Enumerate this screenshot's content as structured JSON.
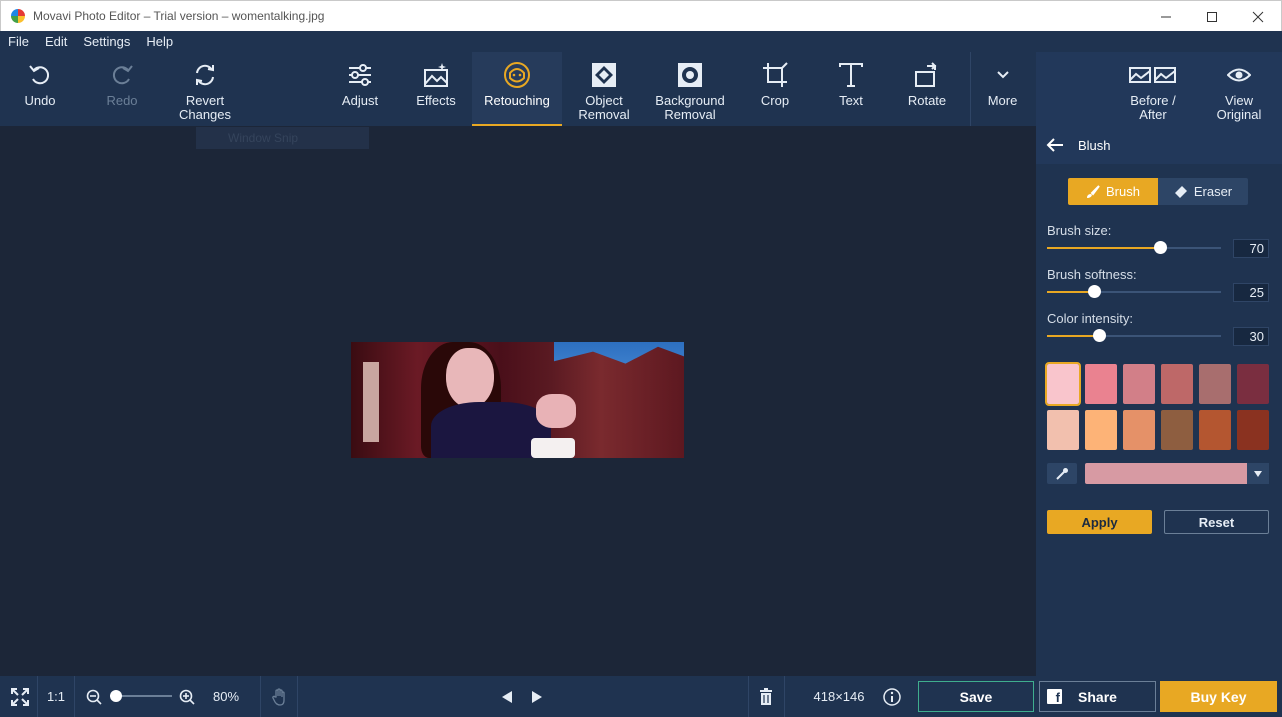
{
  "window": {
    "title": "Movavi Photo Editor – Trial version – womentalking.jpg",
    "controls": [
      "minimize",
      "maximize",
      "close"
    ]
  },
  "menu": [
    "File",
    "Edit",
    "Settings",
    "Help"
  ],
  "toolbar": {
    "undo": "Undo",
    "redo": "Redo",
    "revert": "Revert\nChanges",
    "adjust": "Adjust",
    "effects": "Effects",
    "retouching": "Retouching",
    "object_removal": "Object\nRemoval",
    "background_removal": "Background\nRemoval",
    "crop": "Crop",
    "text": "Text",
    "rotate": "Rotate",
    "more": "More",
    "before_after": "Before /\nAfter",
    "view_original": "View\nOriginal",
    "active_tool": "Retouching",
    "ghost_tooltip": "Window Snip"
  },
  "panel": {
    "title": "Blush",
    "brush_label": "Brush",
    "eraser_label": "Eraser",
    "active_mode": "Brush",
    "sliders": [
      {
        "label": "Brush size:",
        "value": "70",
        "fraction": 0.65
      },
      {
        "label": "Brush softness:",
        "value": "25",
        "fraction": 0.27
      },
      {
        "label": "Color intensity:",
        "value": "30",
        "fraction": 0.3
      }
    ],
    "swatches_row1": [
      "#f9c5cc",
      "#ea8290",
      "#d27f88",
      "#be6868",
      "#a86e6e",
      "#7a2e40"
    ],
    "swatches_row2": [
      "#f2c0ae",
      "#fdb377",
      "#e59168",
      "#8e5e40",
      "#b45630",
      "#8a3220"
    ],
    "selected_swatch": 0,
    "selected_color": "#d79aa3",
    "apply_label": "Apply",
    "reset_label": "Reset"
  },
  "statusbar": {
    "one_to_one": "1:1",
    "zoom_percent": "80%",
    "zoom_fraction": 0.1,
    "dimensions": "418×146",
    "save_label": "Save",
    "share_label": "Share",
    "buy_label": "Buy Key"
  },
  "colors": {
    "accent": "#e8a823",
    "toolbar_bg": "#1f3350",
    "canvas_bg": "#1c2638",
    "save_border": "#3fae8e"
  }
}
